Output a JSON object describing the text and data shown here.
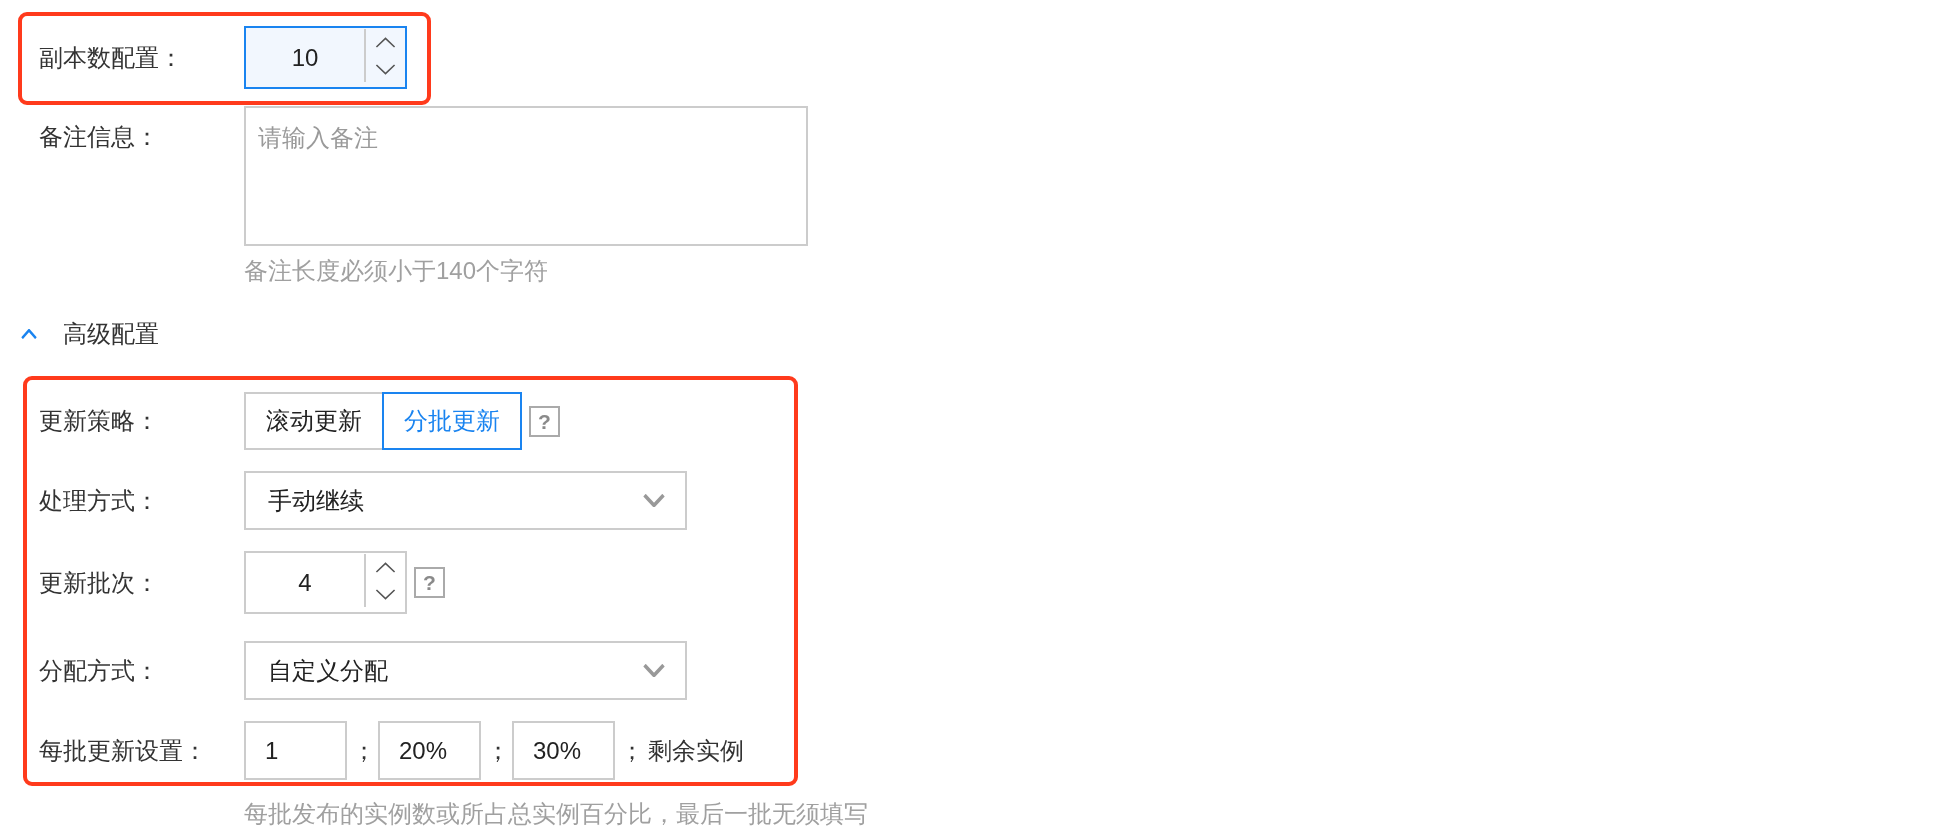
{
  "replicas": {
    "label": "副本数配置：",
    "value": "10",
    "focused": true,
    "highlighted": true
  },
  "notes": {
    "label": "备注信息：",
    "placeholder": "请输入备注",
    "hint": "备注长度必须小于140个字符"
  },
  "advanced": {
    "title": "高级配置",
    "expanded": true,
    "highlighted": true,
    "strategy": {
      "label": "更新策略：",
      "options": [
        {
          "label": "滚动更新",
          "selected": false
        },
        {
          "label": "分批更新",
          "selected": true
        }
      ],
      "help": "?"
    },
    "handling": {
      "label": "处理方式：",
      "value": "手动继续"
    },
    "batches": {
      "label": "更新批次：",
      "value": "4",
      "focused": false,
      "help": "?"
    },
    "allocation": {
      "label": "分配方式：",
      "value": "自定义分配"
    },
    "per_batch": {
      "label": "每批更新设置：",
      "inputs": [
        {
          "value": "1",
          "separator": "；"
        },
        {
          "value": "20%",
          "separator": "；"
        },
        {
          "value": "30%",
          "separator": "；"
        }
      ],
      "remainder": "剩余实例"
    },
    "hint": "每批发布的实例数或所占总实例百分比，最后一批无须填写"
  }
}
